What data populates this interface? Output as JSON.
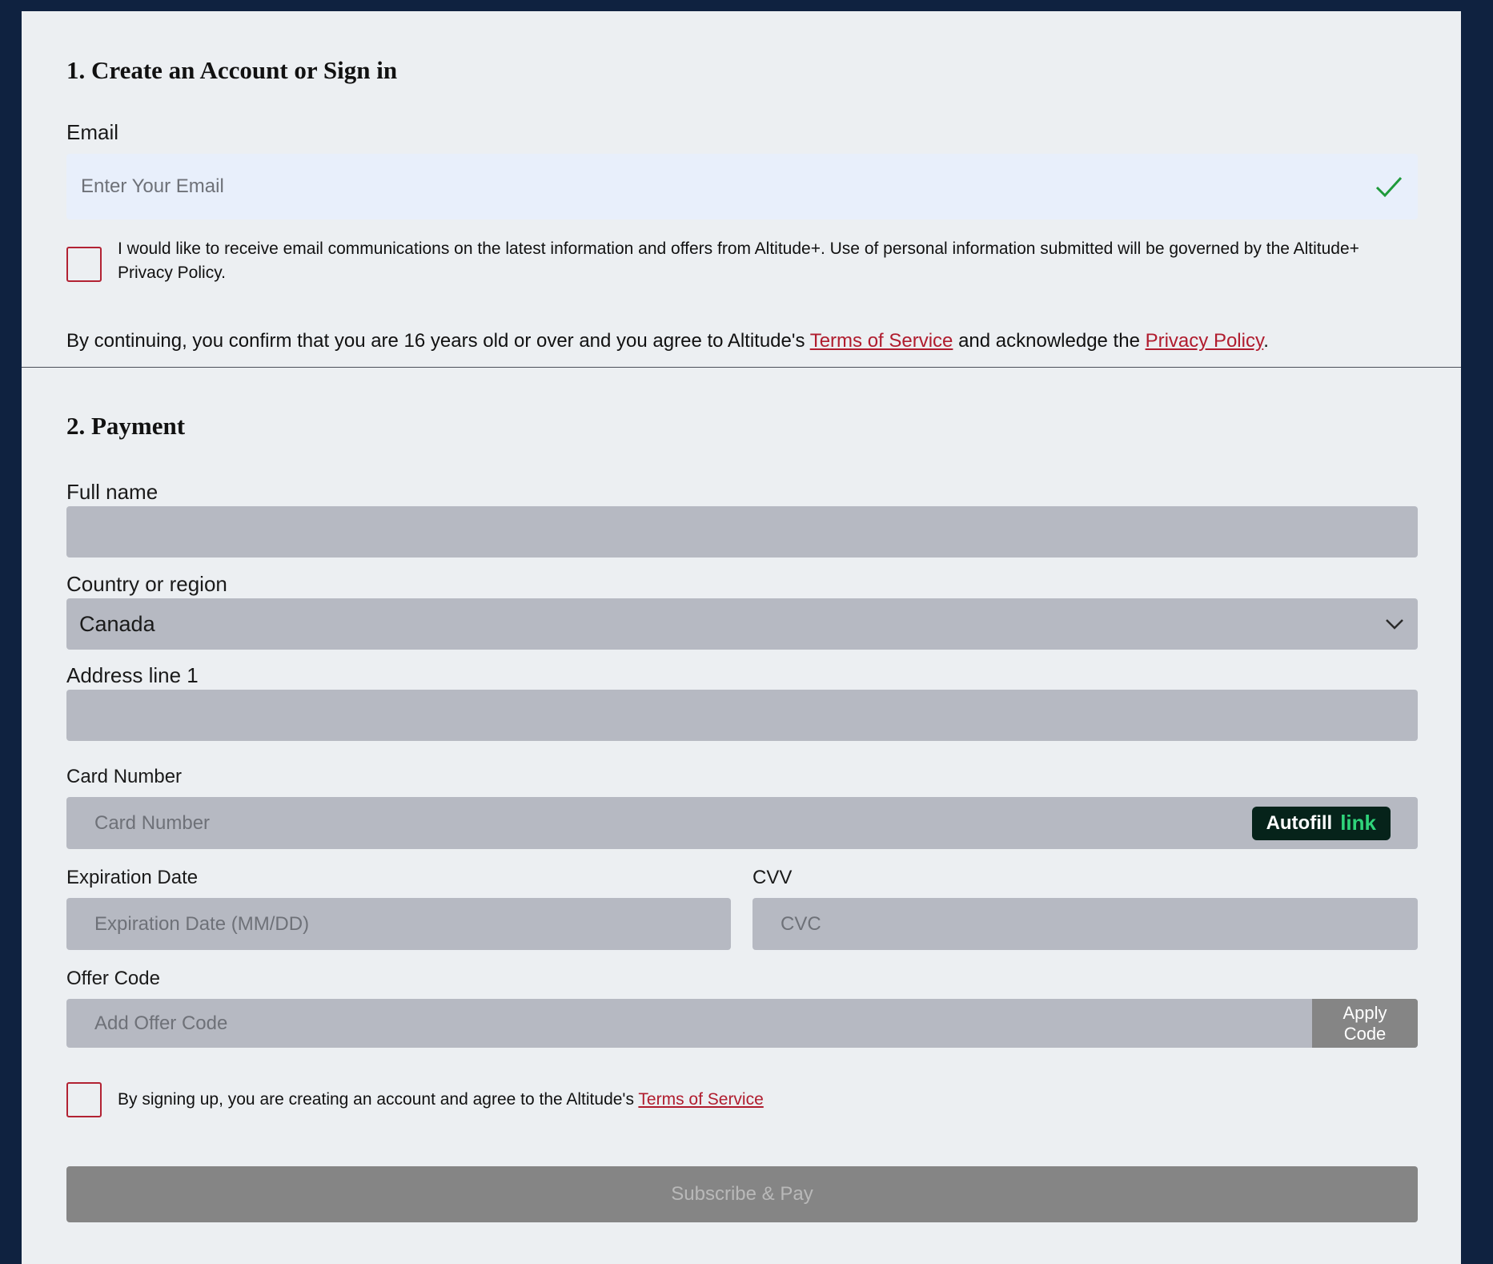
{
  "account": {
    "heading": "1. Create an Account or Sign in",
    "email_label": "Email",
    "email_placeholder": "Enter Your Email",
    "opt_in_text": "I would like to receive email communications on the latest information and offers from Altitude+. Use of personal information submitted will be governed by the Altitude+ Privacy Policy.",
    "confirm_prefix": "By continuing, you confirm that you are 16 years old or over and you agree to Altitude's ",
    "terms_link": "Terms of Service",
    "confirm_middle": " and acknowledge the ",
    "privacy_link": "Privacy Policy",
    "confirm_suffix": "."
  },
  "payment": {
    "heading": "2. Payment",
    "full_name_label": "Full name",
    "country_label": "Country or region",
    "country_value": "Canada",
    "address_label": "Address line 1",
    "card_label": "Card Number",
    "card_placeholder": "Card Number",
    "autofill_text": "Autofill",
    "autofill_link": "link",
    "expiry_label": "Expiration Date",
    "expiry_placeholder": "Expiration Date (MM/DD)",
    "cvv_label": "CVV",
    "cvv_placeholder": "CVC",
    "offer_label": "Offer Code",
    "offer_placeholder": "Add Offer Code",
    "apply_label": "Apply Code",
    "signup_prefix": "By signing up, you are creating an account and agree to the Altitude's ",
    "signup_terms_link": "Terms of Service",
    "submit_label": "Subscribe & Pay"
  },
  "colors": {
    "background": "#0f2240",
    "panel": "#eceff2",
    "field": "#b6b9c2",
    "email_field": "#e8effb",
    "accent_red": "#b01c2e",
    "check_green": "#1e9a3a",
    "autofill_bg": "#06231a",
    "autofill_link": "#2fd47a",
    "submit_bg": "#858585"
  },
  "icons": [
    "check-icon",
    "chevron-down-icon"
  ]
}
